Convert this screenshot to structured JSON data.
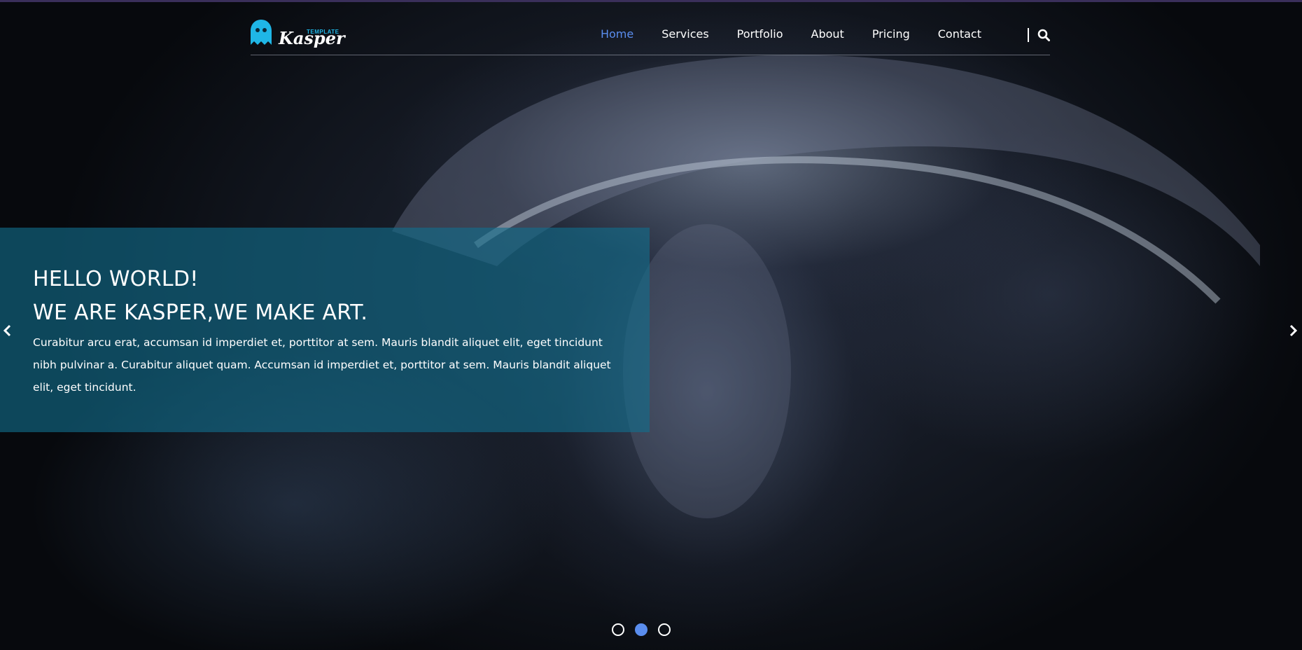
{
  "logo": {
    "small_text": "TEMPLATE",
    "wordmark": "Kasper"
  },
  "nav": {
    "items": [
      {
        "label": "Home",
        "active": true
      },
      {
        "label": "Services",
        "active": false
      },
      {
        "label": "Portfolio",
        "active": false
      },
      {
        "label": "About",
        "active": false
      },
      {
        "label": "Pricing",
        "active": false
      },
      {
        "label": "Contact",
        "active": false
      }
    ]
  },
  "hero": {
    "heading_line1": "HELLO WORLD!",
    "heading_line2": "WE ARE KASPER,WE MAKE ART.",
    "body": "Curabitur arcu erat, accumsan id imperdiet et, porttitor at sem. Mauris blandit aliquet elit, eget tincidunt nibh pulvinar a. Curabitur aliquet quam. Accumsan id imperdiet et, porttitor at sem. Mauris blandit aliquet elit, eget tincidunt."
  },
  "slider": {
    "slide_count": 3,
    "active_index": 1
  },
  "icons": {
    "logo": "ghost-icon",
    "search": "search-icon",
    "prev": "chevron-left-icon",
    "next": "chevron-right-icon"
  },
  "colors": {
    "accent": "#5a8dee",
    "panel": "#126e8c",
    "logo_icon": "#1fb6e6"
  }
}
